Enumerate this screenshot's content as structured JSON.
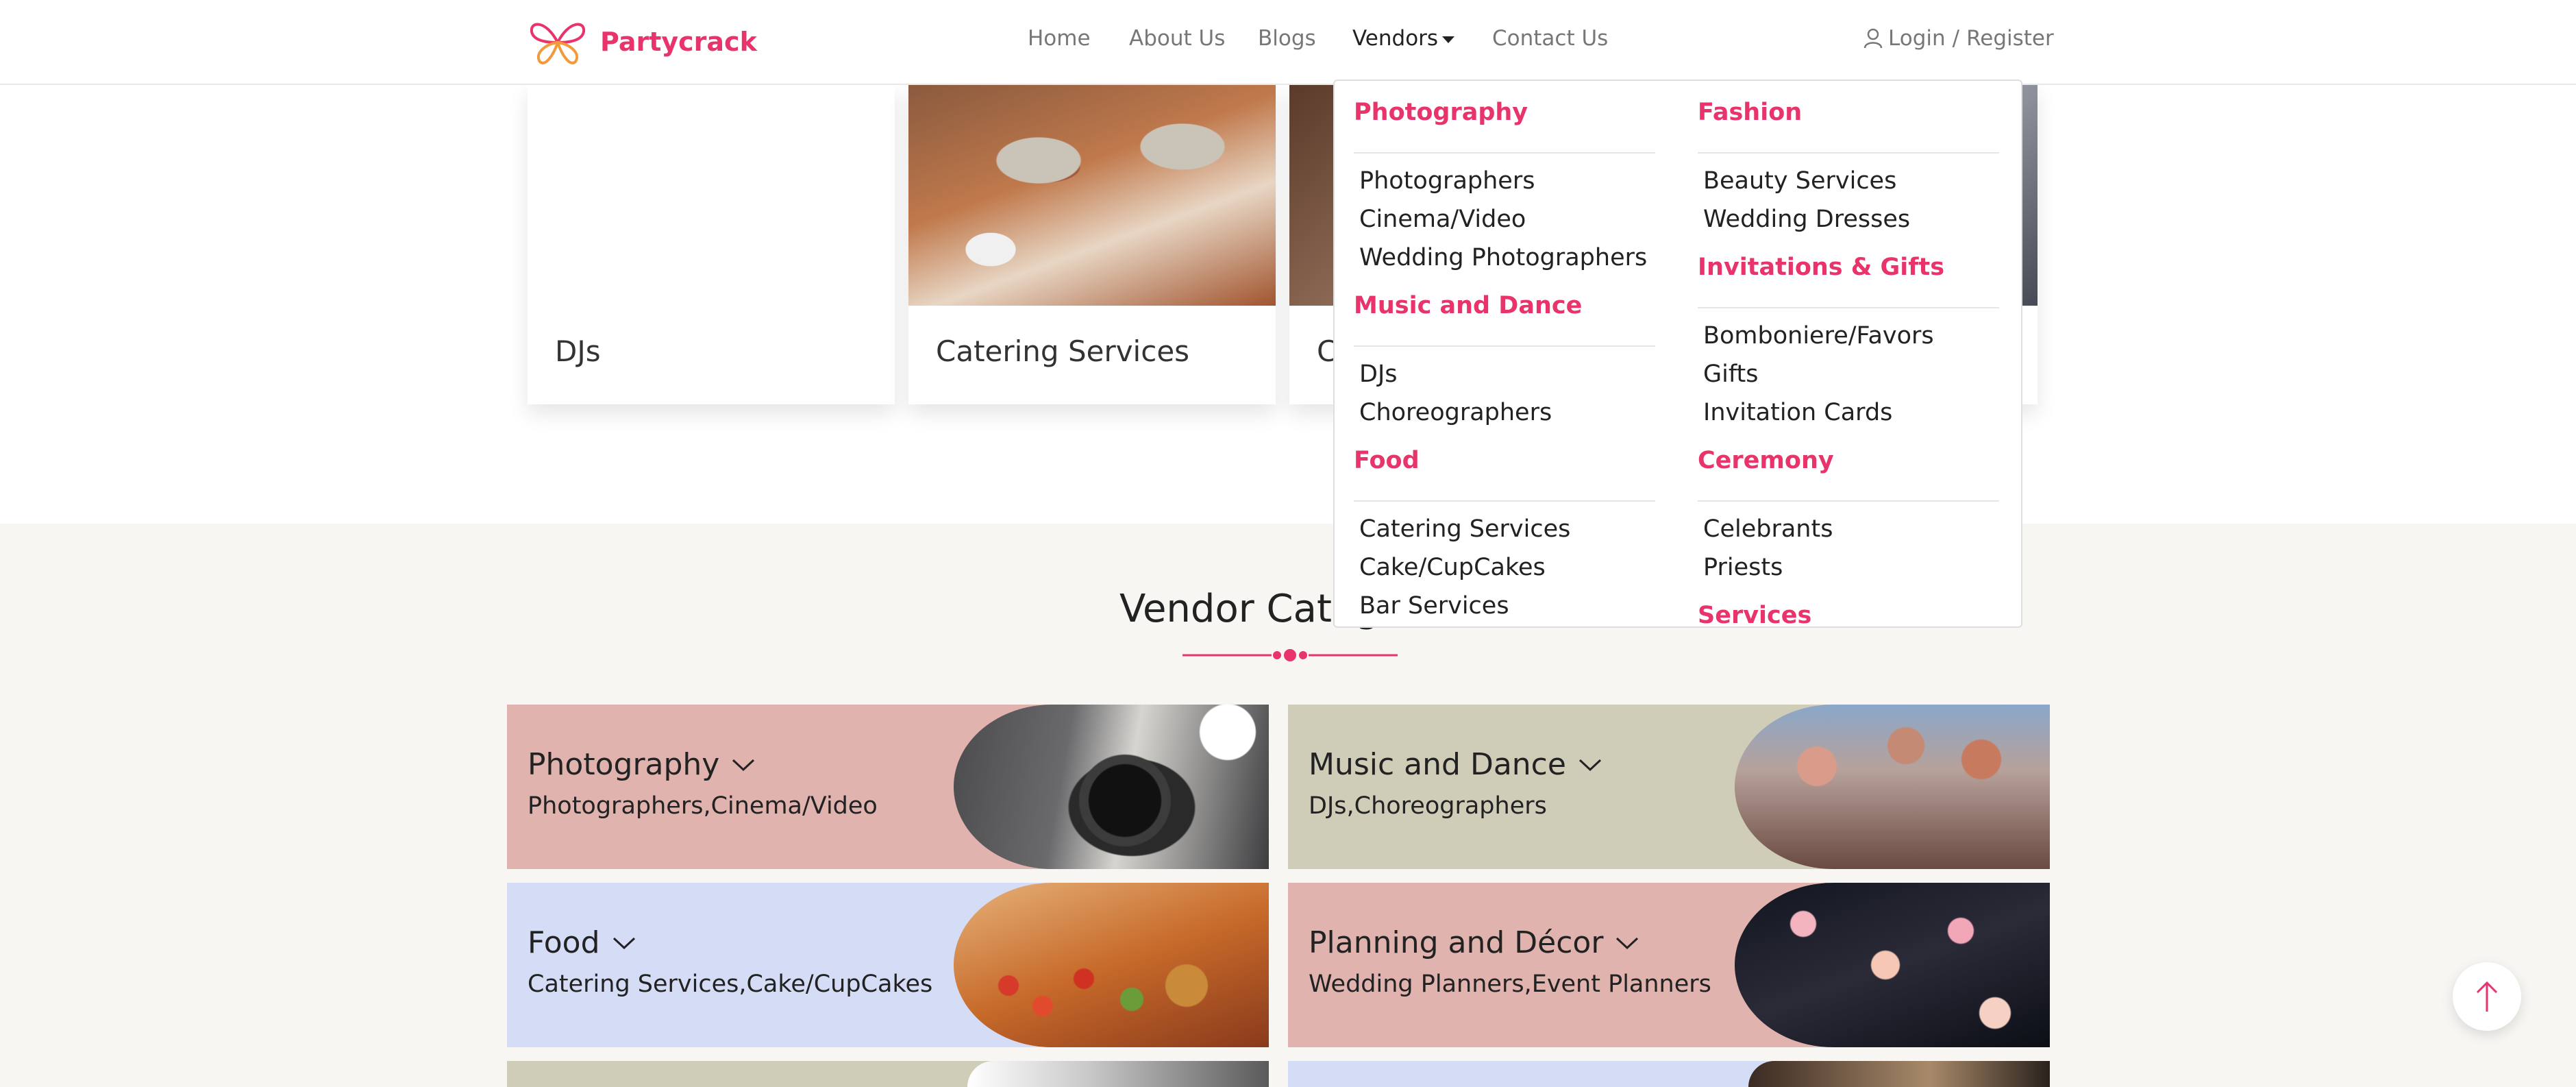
{
  "brand": {
    "name": "Partycrack",
    "accent": "#e8336b"
  },
  "nav": {
    "home": "Home",
    "about": "About Us",
    "blogs": "Blogs",
    "vendors": "Vendors",
    "contact": "Contact Us"
  },
  "auth": {
    "login": "Login",
    "separator": "/",
    "register": "Register"
  },
  "top_cards": [
    {
      "label": "DJs"
    },
    {
      "label": "Catering Services"
    },
    {
      "label": "C"
    }
  ],
  "section": {
    "title": "Vendor Categ"
  },
  "categories": [
    {
      "name": "Photography",
      "subs": "Photographers,Cinema/Video",
      "bg": "#e0b3ae"
    },
    {
      "name": "Music and Dance",
      "subs": "DJs,Choreographers",
      "bg": "#cfccb8"
    },
    {
      "name": "Food",
      "subs": "Catering Services,Cake/CupCakes",
      "bg": "#d5dcf6"
    },
    {
      "name": "Planning and Décor",
      "subs": "Wedding Planners,Event Planners",
      "bg": "#e0b3ae"
    }
  ],
  "dropdown": {
    "left": [
      {
        "heading": "Photography",
        "items": [
          "Photographers",
          "Cinema/Video",
          "Wedding Photographers"
        ]
      },
      {
        "heading": "Music and Dance",
        "items": [
          "DJs",
          "Choreographers"
        ]
      },
      {
        "heading": "Food",
        "items": [
          "Catering Services",
          "Cake/CupCakes",
          "Bar Services"
        ]
      }
    ],
    "right": [
      {
        "heading": "Fashion",
        "items": [
          "Beauty Services",
          "Wedding Dresses"
        ]
      },
      {
        "heading": "Invitations & Gifts",
        "items": [
          "Bomboniere/Favors",
          "Gifts",
          "Invitation Cards"
        ]
      },
      {
        "heading": "Ceremony",
        "items": [
          "Celebrants",
          "Priests"
        ]
      },
      {
        "heading": "Services",
        "items": []
      }
    ]
  },
  "icons": {
    "user": "user-icon",
    "caret": "caret-down-icon",
    "chevron": "chevron-down-icon",
    "scroll_top": "arrow-up-icon",
    "logo": "butterfly-logo-icon"
  }
}
